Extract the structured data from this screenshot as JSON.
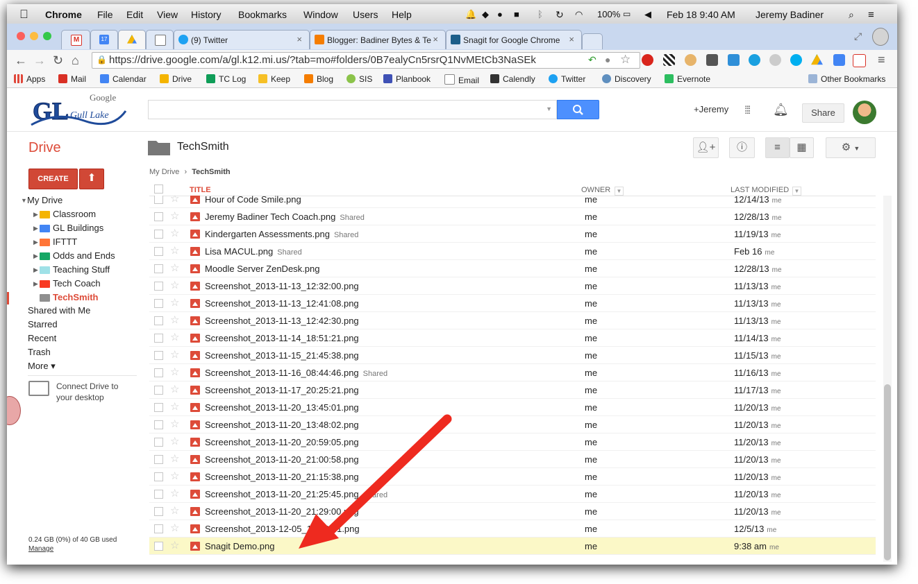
{
  "mac_menu": {
    "apple": "",
    "app": "Chrome",
    "items": [
      "File",
      "Edit",
      "View",
      "History",
      "Bookmarks",
      "Window",
      "Users",
      "Help"
    ],
    "battery": "100%",
    "datetime": "Feb 18  9:40 AM",
    "user": "Jeremy Badiner"
  },
  "tabs": [
    {
      "label": "",
      "icon": "gmail-icon"
    },
    {
      "label": "",
      "icon": "calendar-icon",
      "badge": "17"
    },
    {
      "label": "",
      "icon": "drive-icon"
    },
    {
      "label": "",
      "icon": "email-icon"
    },
    {
      "label": "(9) Twitter",
      "icon": "twitter-icon"
    },
    {
      "label": "Blogger: Badiner Bytes & Te",
      "icon": "blogger-icon"
    },
    {
      "label": "Snagit for Google Chrome",
      "icon": "snagit-icon"
    }
  ],
  "address": {
    "url": "https://drive.google.com/a/gl.k12.mi.us/?tab=mo#folders/0B7ealyCn5rsrQ1NvMEtCb3NaSEk"
  },
  "bookmarks": [
    {
      "label": "Apps",
      "color": "#e0473a"
    },
    {
      "label": "Mail",
      "color": "#d93025"
    },
    {
      "label": "Calendar",
      "color": "#4285f4"
    },
    {
      "label": "Drive",
      "color": "#f4b400"
    },
    {
      "label": "TC Log",
      "color": "#0f9d58"
    },
    {
      "label": "Keep",
      "color": "#f6c026"
    },
    {
      "label": "Blog",
      "color": "#f57d00"
    },
    {
      "label": "SIS",
      "color": "#8bc34a"
    },
    {
      "label": "Planbook",
      "color": "#3f51b5"
    },
    {
      "label": "Email",
      "color": "#9e9e9e"
    },
    {
      "label": "Calendly",
      "color": "#333333"
    },
    {
      "label": "Twitter",
      "color": "#1da1f2"
    },
    {
      "label": "Discovery",
      "color": "#5f8fbf"
    },
    {
      "label": "Evernote",
      "color": "#2dbe60"
    }
  ],
  "other_bookmarks": "Other Bookmarks",
  "header": {
    "logo_brand": "Google",
    "user_link": "+Jeremy",
    "share": "Share"
  },
  "drive": {
    "title": "Drive",
    "folder": "TechSmith",
    "create": "CREATE",
    "breadcrumb_root": "My Drive",
    "breadcrumb_sep": "›",
    "breadcrumb_current": "TechSmith"
  },
  "nav": {
    "my_drive": "My Drive",
    "folders": [
      {
        "label": "Classroom",
        "color": "#f4b400",
        "active": false
      },
      {
        "label": "GL Buildings",
        "color": "#4285f4",
        "active": false
      },
      {
        "label": "IFTTT",
        "color": "#ff7537",
        "active": false
      },
      {
        "label": "Odds and Ends",
        "color": "#16a765",
        "active": false
      },
      {
        "label": "Teaching Stuff",
        "color": "#9fe1e7",
        "active": false
      },
      {
        "label": "Tech Coach",
        "color": "#f83a22",
        "active": false
      },
      {
        "label": "TechSmith",
        "color": "#8f8f8f",
        "active": true
      }
    ],
    "links": [
      "Shared with Me",
      "Starred",
      "Recent",
      "Trash",
      "More ▾"
    ],
    "connect": "Connect Drive to your desktop",
    "storage": "0.24 GB (0%) of 40 GB used",
    "manage": "Manage"
  },
  "table": {
    "col_title": "TITLE",
    "col_owner": "OWNER",
    "col_modified": "LAST MODIFIED",
    "rows": [
      {
        "name": "Hour of Code Smile.png",
        "shared": "",
        "owner": "me",
        "modified": "12/14/13",
        "by": "me"
      },
      {
        "name": "Jeremy Badiner Tech Coach.png",
        "shared": "Shared",
        "owner": "me",
        "modified": "12/28/13",
        "by": "me"
      },
      {
        "name": "Kindergarten Assessments.png",
        "shared": "Shared",
        "owner": "me",
        "modified": "11/19/13",
        "by": "me"
      },
      {
        "name": "Lisa MACUL.png",
        "shared": "Shared",
        "owner": "me",
        "modified": "Feb 16",
        "by": "me"
      },
      {
        "name": "Moodle Server ZenDesk.png",
        "shared": "",
        "owner": "me",
        "modified": "12/28/13",
        "by": "me"
      },
      {
        "name": "Screenshot_2013-11-13_12:32:00.png",
        "shared": "",
        "owner": "me",
        "modified": "11/13/13",
        "by": "me"
      },
      {
        "name": "Screenshot_2013-11-13_12:41:08.png",
        "shared": "",
        "owner": "me",
        "modified": "11/13/13",
        "by": "me"
      },
      {
        "name": "Screenshot_2013-11-13_12:42:30.png",
        "shared": "",
        "owner": "me",
        "modified": "11/13/13",
        "by": "me"
      },
      {
        "name": "Screenshot_2013-11-14_18:51:21.png",
        "shared": "",
        "owner": "me",
        "modified": "11/14/13",
        "by": "me"
      },
      {
        "name": "Screenshot_2013-11-15_21:45:38.png",
        "shared": "",
        "owner": "me",
        "modified": "11/15/13",
        "by": "me"
      },
      {
        "name": "Screenshot_2013-11-16_08:44:46.png",
        "shared": "Shared",
        "owner": "me",
        "modified": "11/16/13",
        "by": "me"
      },
      {
        "name": "Screenshot_2013-11-17_20:25:21.png",
        "shared": "",
        "owner": "me",
        "modified": "11/17/13",
        "by": "me"
      },
      {
        "name": "Screenshot_2013-11-20_13:45:01.png",
        "shared": "",
        "owner": "me",
        "modified": "11/20/13",
        "by": "me"
      },
      {
        "name": "Screenshot_2013-11-20_13:48:02.png",
        "shared": "",
        "owner": "me",
        "modified": "11/20/13",
        "by": "me"
      },
      {
        "name": "Screenshot_2013-11-20_20:59:05.png",
        "shared": "",
        "owner": "me",
        "modified": "11/20/13",
        "by": "me"
      },
      {
        "name": "Screenshot_2013-11-20_21:00:58.png",
        "shared": "",
        "owner": "me",
        "modified": "11/20/13",
        "by": "me"
      },
      {
        "name": "Screenshot_2013-11-20_21:15:38.png",
        "shared": "",
        "owner": "me",
        "modified": "11/20/13",
        "by": "me"
      },
      {
        "name": "Screenshot_2013-11-20_21:25:45.png",
        "shared": "Shared",
        "owner": "me",
        "modified": "11/20/13",
        "by": "me"
      },
      {
        "name": "Screenshot_2013-11-20_21:29:00.png",
        "shared": "",
        "owner": "me",
        "modified": "11/20/13",
        "by": "me"
      },
      {
        "name": "Screenshot_2013-12-05_10:40:41.png",
        "shared": "",
        "owner": "me",
        "modified": "12/5/13",
        "by": "me"
      },
      {
        "name": "Snagit Demo.png",
        "shared": "",
        "owner": "me",
        "modified": "9:38 am",
        "by": "me",
        "highlight": true
      }
    ]
  },
  "colors": {
    "drive_red": "#dd4b39",
    "create_red": "#d14836",
    "search_blue": "#4d90fe",
    "highlight_row": "#fbf8c7",
    "annotation_arrow": "#ee2a1f"
  }
}
